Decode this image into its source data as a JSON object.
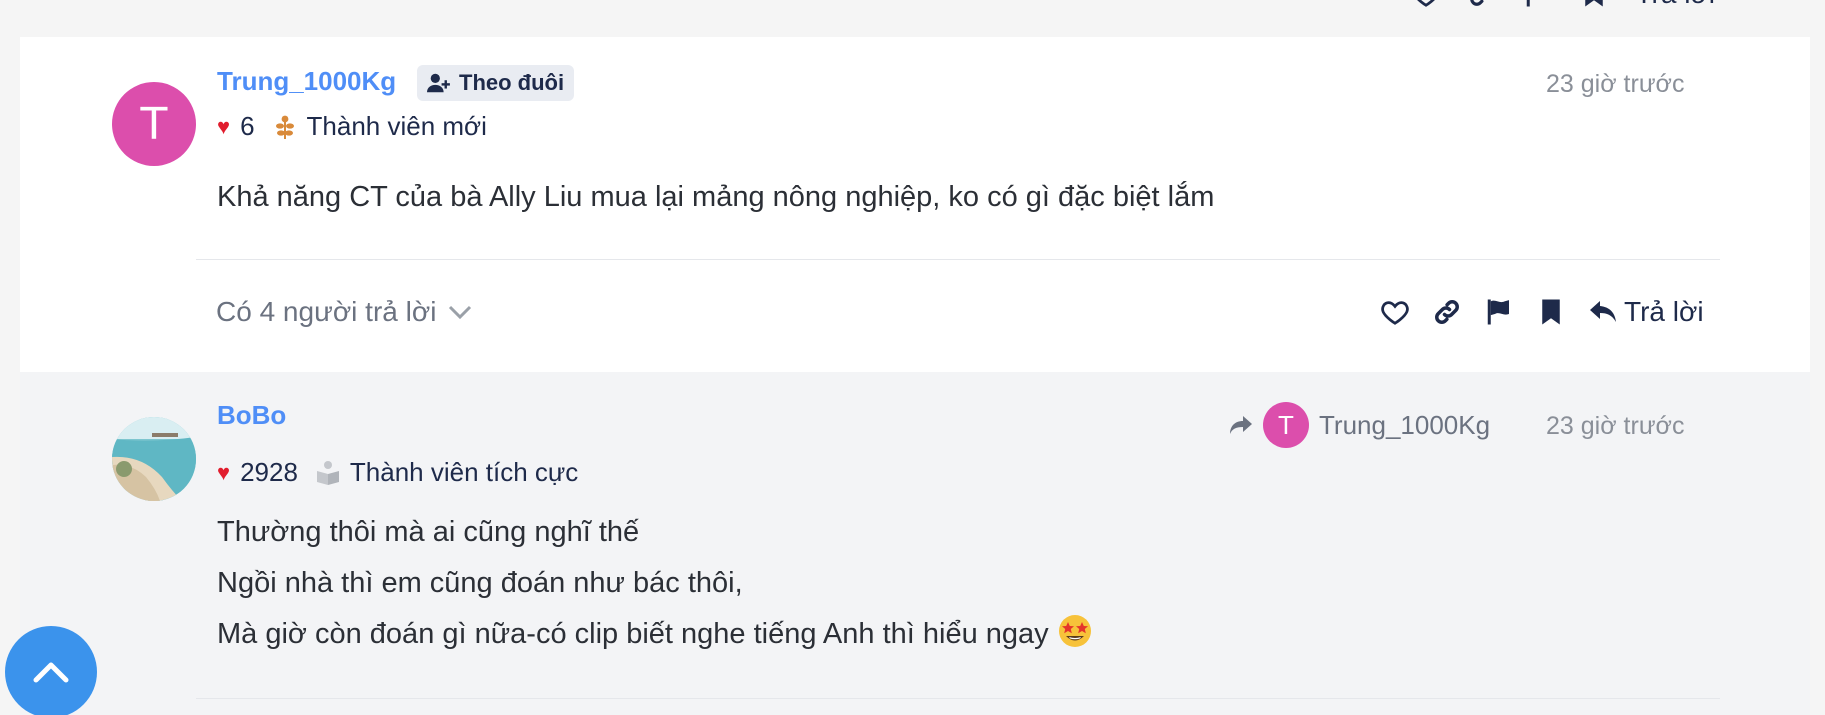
{
  "top_strip": {
    "reply_label": "Trả lời"
  },
  "comments": [
    {
      "avatar_letter": "T",
      "username": "Trung_1000Kg",
      "follow_label": "Theo đuôi",
      "time": "23 giờ trước",
      "likes": "6",
      "rank": "Thành viên mới",
      "content": [
        "Khả năng CT của bà Ally Liu mua lại mảng nông nghiệp, ko có gì đặc biệt lắm"
      ],
      "replies_label": "Có 4 người trả lời",
      "reply_label": "Trả lời"
    },
    {
      "username": "BoBo",
      "time": "23 giờ trước",
      "likes": "2928",
      "rank": "Thành viên tích cực",
      "reply_to": {
        "avatar_letter": "T",
        "username": "Trung_1000Kg"
      },
      "content": [
        "Thường thôi mà ai cũng nghĩ thế",
        "Ngồi nhà thì em cũng đoán như bác thôi,",
        "Mà giờ còn đoán gì nữa-có clip biết nghe tiếng Anh thì hiểu ngay"
      ]
    }
  ],
  "icons": {
    "heart_outline": "heart-icon",
    "link": "link-icon",
    "flag": "flag-icon",
    "bookmark": "bookmark-icon",
    "reply": "reply-icon",
    "scroll_top": "chevron-up-icon"
  },
  "colors": {
    "username": "#4f8ef7",
    "avatar_pink": "#dc4eac",
    "heart": "#e11d2e",
    "scroll_button": "#3b93ec",
    "action_icons": "#1e2a4a"
  }
}
